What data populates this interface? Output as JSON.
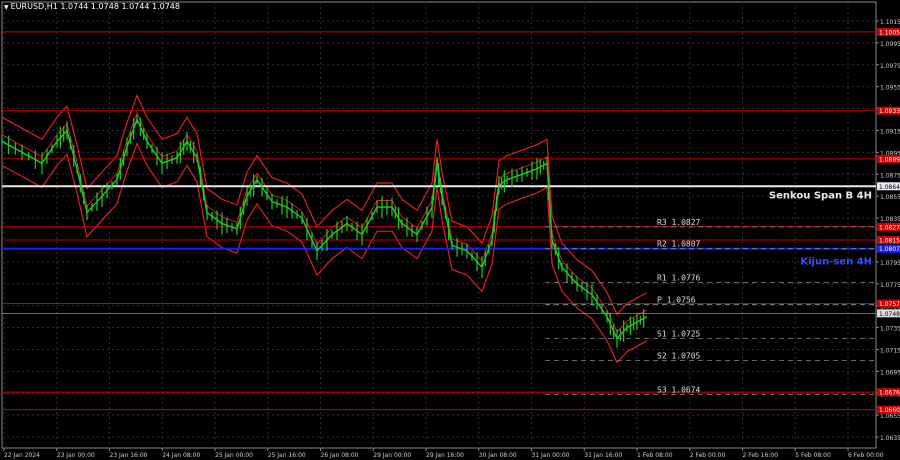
{
  "header": {
    "symbol_line": "EURUSD,H1  1.0744 1.0748 1.0744 1.0748"
  },
  "chart_data": {
    "type": "line",
    "title": "EURUSD,H1",
    "ylim": [
      1.0625,
      1.1025
    ],
    "y_ticks": [
      1.1015,
      1.0995,
      1.0975,
      1.0955,
      1.0935,
      1.0915,
      1.0895,
      1.0875,
      1.0855,
      1.0835,
      1.0815,
      1.0795,
      1.0775,
      1.0755,
      1.0735,
      1.0715,
      1.0695,
      1.0675,
      1.0655,
      1.0635
    ],
    "x_ticks": [
      "22 Jan 2024",
      "23 Jan 00:00",
      "23 Jan 16:00",
      "24 Jan 08:00",
      "25 Jan 00:00",
      "25 Jan 16:00",
      "26 Jan 08:00",
      "29 Jan 00:00",
      "29 Jan 16:00",
      "30 Jan 08:00",
      "31 Jan 00:00",
      "31 Jan 16:00",
      "1 Feb 08:00",
      "2 Feb 00:00",
      "2 Feb 16:00",
      "5 Feb 08:00",
      "6 Feb 00:00"
    ],
    "series": [
      {
        "color": "#22cc22",
        "points": [
          [
            0,
            1.0905
          ],
          [
            20,
            1.0895
          ],
          [
            40,
            1.0885
          ],
          [
            55,
            1.0905
          ],
          [
            65,
            1.0915
          ],
          [
            75,
            1.088
          ],
          [
            85,
            1.084
          ],
          [
            100,
            1.0855
          ],
          [
            115,
            1.087
          ],
          [
            125,
            1.09
          ],
          [
            135,
            1.0925
          ],
          [
            145,
            1.0905
          ],
          [
            160,
            1.0885
          ],
          [
            175,
            1.089
          ],
          [
            185,
            1.0905
          ],
          [
            195,
            1.089
          ],
          [
            205,
            1.084
          ],
          [
            220,
            1.083
          ],
          [
            235,
            1.0825
          ],
          [
            245,
            1.0855
          ],
          [
            255,
            1.087
          ],
          [
            270,
            1.085
          ],
          [
            285,
            1.0845
          ],
          [
            300,
            1.0835
          ],
          [
            315,
            1.0805
          ],
          [
            330,
            1.082
          ],
          [
            345,
            1.083
          ],
          [
            360,
            1.082
          ],
          [
            375,
            1.0845
          ],
          [
            390,
            1.0845
          ],
          [
            400,
            1.083
          ],
          [
            415,
            1.082
          ],
          [
            430,
            1.0845
          ],
          [
            435,
            1.0885
          ],
          [
            440,
            1.0855
          ],
          [
            450,
            1.081
          ],
          [
            465,
            1.0805
          ],
          [
            480,
            1.079
          ],
          [
            490,
            1.0815
          ],
          [
            497,
            1.0865
          ],
          [
            505,
            1.087
          ],
          [
            520,
            1.0875
          ],
          [
            535,
            1.088
          ],
          [
            545,
            1.0885
          ],
          [
            550,
            1.0815
          ],
          [
            560,
            1.079
          ],
          [
            575,
            1.0775
          ],
          [
            590,
            1.0765
          ],
          [
            605,
            1.0745
          ],
          [
            615,
            1.0725
          ],
          [
            625,
            1.0735
          ],
          [
            635,
            1.074
          ],
          [
            645,
            1.0745
          ]
        ]
      }
    ],
    "levels": [
      {
        "value": 1.1005,
        "color": "#cc0000",
        "label": "1.1005",
        "style": "solid"
      },
      {
        "value": 1.0933,
        "color": "#cc0000",
        "label": "1.0933",
        "style": "solid"
      },
      {
        "value": 1.0889,
        "color": "#cc0000",
        "label": "1.0889",
        "style": "solid"
      },
      {
        "value": 1.0864,
        "color": "#e8e8f0",
        "label": "1.0864",
        "style": "solid",
        "name": "Senkou Span B 4H",
        "width": 2
      },
      {
        "value": 1.0827,
        "color": "#cc0000",
        "label": "1.0827",
        "style": "solid"
      },
      {
        "value": 1.0815,
        "color": "#cc0000",
        "label": "1.0815",
        "style": "solid"
      },
      {
        "value": 1.0807,
        "color": "#1a1aff",
        "label": "1.0807",
        "style": "solid",
        "name": "Kijun-sen 4H",
        "width": 2
      },
      {
        "value": 1.0757,
        "color": "#cc0000",
        "label": "1.0757",
        "style": "solid"
      },
      {
        "value": 1.0676,
        "color": "#cc0000",
        "label": "1.0676",
        "style": "solid"
      },
      {
        "value": 1.066,
        "color": "#cc0000",
        "label": "1.0660",
        "style": "solid"
      }
    ],
    "current_price": {
      "value": 1.0748,
      "label": "1.0748"
    },
    "pivots": [
      {
        "name": "R3",
        "value": "1.0827",
        "y": 1.0827
      },
      {
        "name": "R2",
        "value": "1.0807",
        "y": 1.0807
      },
      {
        "name": "R1",
        "value": "1.0776",
        "y": 1.0776
      },
      {
        "name": "P",
        "value": "1.0756",
        "y": 1.0756
      },
      {
        "name": "S1",
        "value": "1.0725",
        "y": 1.0725
      },
      {
        "name": "S2",
        "value": "1.0705",
        "y": 1.0705
      },
      {
        "name": "S3",
        "value": "1.0674",
        "y": 1.0674
      }
    ],
    "grid": true,
    "background": "#000000"
  }
}
